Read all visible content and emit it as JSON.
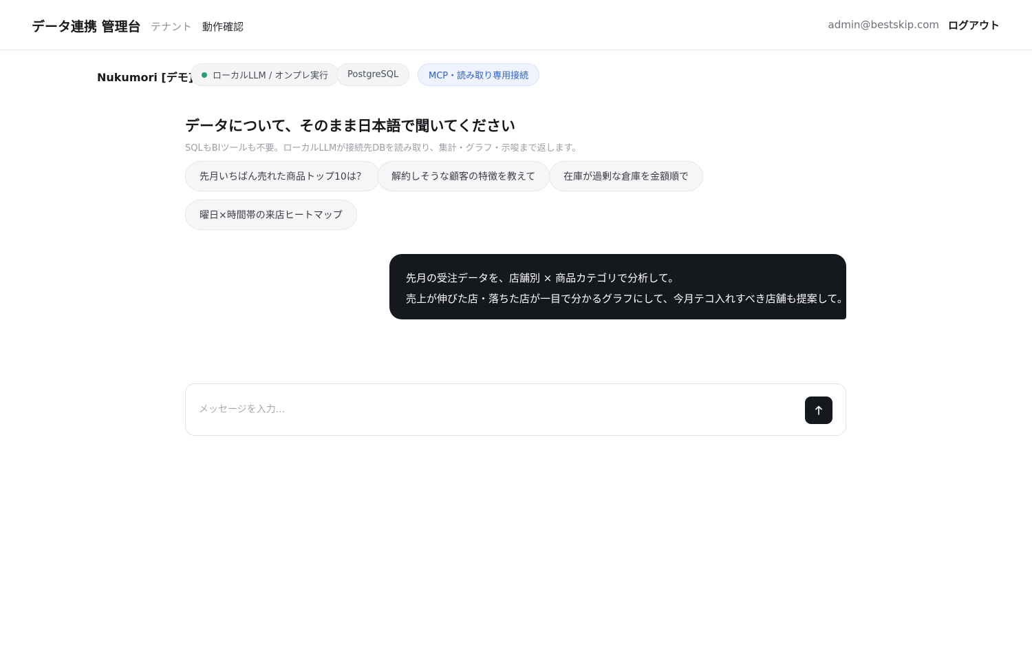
{
  "header": {
    "brand": "データ連携 管理台",
    "nav": {
      "tenants": "テナント",
      "check": "動作確認"
    },
    "user_email": "admin@bestskip.com",
    "logout": "ログアウト"
  },
  "context": {
    "tenant_name": "Nukumori [デモ]",
    "chips": {
      "llm": "ローカルLLM / オンプレ実行",
      "db": "PostgreSQL",
      "mcp": "MCP・読み取り専用接続"
    },
    "status_color": "#22a06b"
  },
  "hero": {
    "title": "データについて、そのまま日本語で聞いてください",
    "subtitle": "SQLもBIツールも不要。ローカルLLMが接続先DBを読み取り、集計・グラフ・示唆まで返します。"
  },
  "suggestions": [
    "先月いちばん売れた商品トップ10は？",
    "解約しそうな顧客の特徴を教えて",
    "在庫が過剰な倉庫を金額順で",
    "曜日×時間帯の来店ヒートマップ"
  ],
  "messages": [
    {
      "role": "user",
      "lines": [
        "先月の受注データを、店舗別 × 商品カテゴリで分析して。",
        "売上が伸びた店・落ちた店が一目で分かるグラフにして、今月テコ入れすべき店舗も提案して。"
      ]
    }
  ],
  "composer": {
    "placeholder": "メッセージを入力...",
    "value": "",
    "send_icon": "arrow-up-icon"
  }
}
